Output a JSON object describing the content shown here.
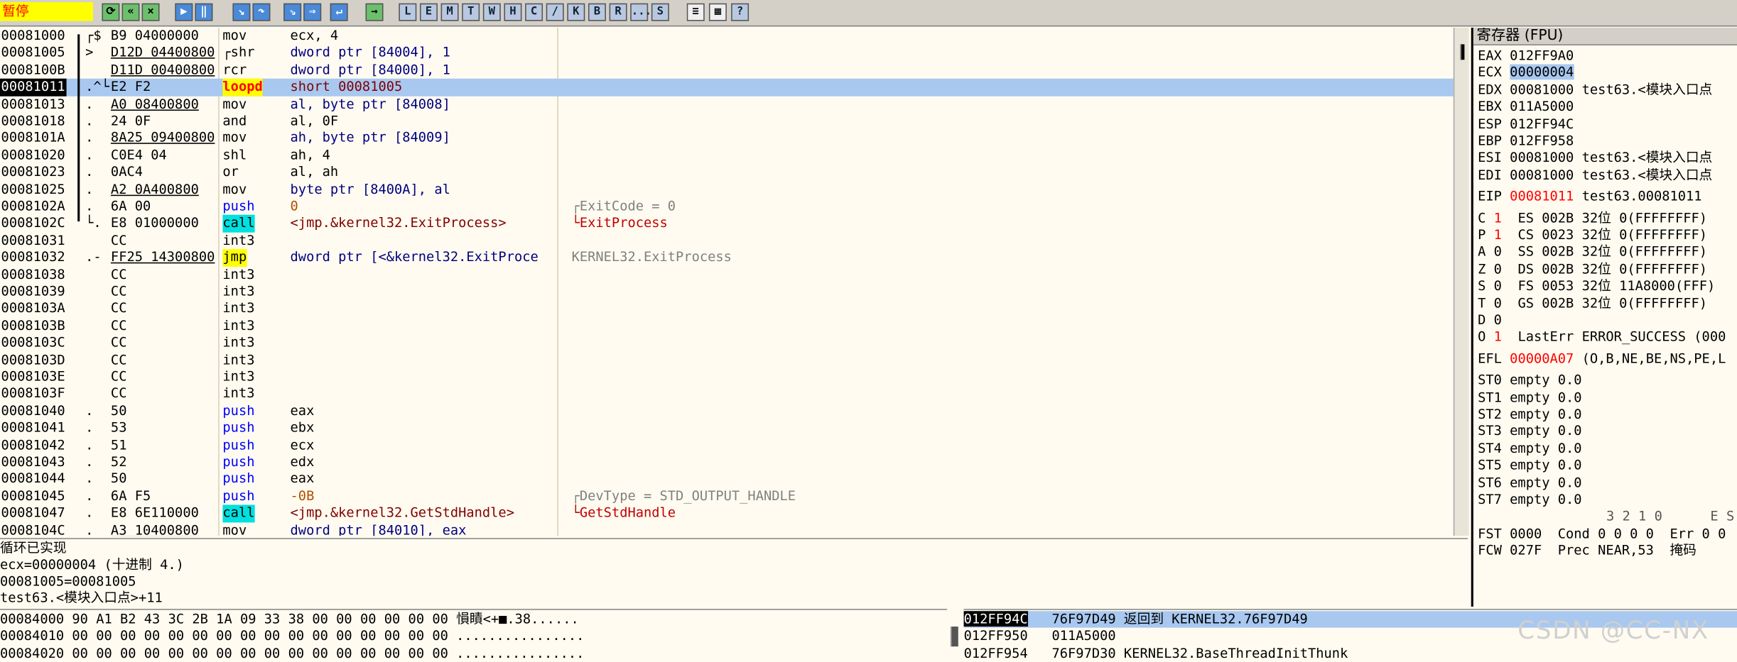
{
  "status": "暂停",
  "toolbar": {
    "buttons": [
      "L",
      "E",
      "M",
      "T",
      "W",
      "H",
      "C",
      "/",
      "K",
      "B",
      "R",
      "...",
      "S"
    ]
  },
  "disasm": [
    {
      "addr": "00081000",
      "dot": "┌$",
      "hex": "B9 04000000",
      "mnem": "mov",
      "ops": "ecx, 4"
    },
    {
      "addr": "00081005",
      "dot": ">",
      "hex": "D12D 04400800",
      "mnem": "┌shr",
      "ops": "dword ptr [84004], 1"
    },
    {
      "addr": "0008100B",
      "dot": "",
      "hex": "D11D 00400800",
      "mnem": "rcr",
      "ops": "dword ptr [84000], 1"
    },
    {
      "addr": "00081011",
      "dot": ".^└",
      "hex": "E2 F2",
      "mnem": "loopd",
      "ops": "short 00081005"
    },
    {
      "addr": "00081013",
      "dot": ".",
      "hex": "A0 08400800",
      "mnem": "mov",
      "ops": "al, byte ptr [84008]"
    },
    {
      "addr": "00081018",
      "dot": ".",
      "hex": "24 0F",
      "mnem": "and",
      "ops": "al, 0F"
    },
    {
      "addr": "0008101A",
      "dot": ".",
      "hex": "8A25 09400800",
      "mnem": "mov",
      "ops": "ah, byte ptr [84009]"
    },
    {
      "addr": "00081020",
      "dot": ".",
      "hex": "C0E4 04",
      "mnem": "shl",
      "ops": "ah, 4"
    },
    {
      "addr": "00081023",
      "dot": ".",
      "hex": "0AC4",
      "mnem": "or",
      "ops": "al, ah"
    },
    {
      "addr": "00081025",
      "dot": ".",
      "hex": "A2 0A400800",
      "mnem": "mov",
      "ops": "byte ptr [8400A], al"
    },
    {
      "addr": "0008102A",
      "dot": ".",
      "hex": "6A 00",
      "mnem": "push",
      "ops": "0",
      "cmt": "┌ExitCode = 0"
    },
    {
      "addr": "0008102C",
      "dot": "└.",
      "hex": "E8 01000000",
      "mnem": "call",
      "ops": "<jmp.&kernel32.ExitProcess>",
      "cmt": "└ExitProcess"
    },
    {
      "addr": "00081031",
      "dot": "",
      "hex": "CC",
      "mnem": "int3",
      "ops": ""
    },
    {
      "addr": "00081032",
      "dot": ".-",
      "hex": "FF25 14300800",
      "mnem": "jmp",
      "ops": "dword ptr [<&kernel32.ExitProce",
      "cmt": "KERNEL32.ExitProcess"
    },
    {
      "addr": "00081038",
      "dot": "",
      "hex": "CC",
      "mnem": "int3",
      "ops": ""
    },
    {
      "addr": "00081039",
      "dot": "",
      "hex": "CC",
      "mnem": "int3",
      "ops": ""
    },
    {
      "addr": "0008103A",
      "dot": "",
      "hex": "CC",
      "mnem": "int3",
      "ops": ""
    },
    {
      "addr": "0008103B",
      "dot": "",
      "hex": "CC",
      "mnem": "int3",
      "ops": ""
    },
    {
      "addr": "0008103C",
      "dot": "",
      "hex": "CC",
      "mnem": "int3",
      "ops": ""
    },
    {
      "addr": "0008103D",
      "dot": "",
      "hex": "CC",
      "mnem": "int3",
      "ops": ""
    },
    {
      "addr": "0008103E",
      "dot": "",
      "hex": "CC",
      "mnem": "int3",
      "ops": ""
    },
    {
      "addr": "0008103F",
      "dot": "",
      "hex": "CC",
      "mnem": "int3",
      "ops": ""
    },
    {
      "addr": "00081040",
      "dot": ".",
      "hex": "50",
      "mnem": "push",
      "ops": "eax"
    },
    {
      "addr": "00081041",
      "dot": ".",
      "hex": "53",
      "mnem": "push",
      "ops": "ebx"
    },
    {
      "addr": "00081042",
      "dot": ".",
      "hex": "51",
      "mnem": "push",
      "ops": "ecx"
    },
    {
      "addr": "00081043",
      "dot": ".",
      "hex": "52",
      "mnem": "push",
      "ops": "edx"
    },
    {
      "addr": "00081044",
      "dot": ".",
      "hex": "50",
      "mnem": "push",
      "ops": "eax"
    },
    {
      "addr": "00081045",
      "dot": ".",
      "hex": "6A F5",
      "mnem": "push",
      "ops": "-0B",
      "cmt": "┌DevType = STD_OUTPUT_HANDLE"
    },
    {
      "addr": "00081047",
      "dot": ".",
      "hex": "E8 6E110000",
      "mnem": "call",
      "ops": "<jmp.&kernel32.GetStdHandle>",
      "cmt": "└GetStdHandle"
    },
    {
      "addr": "0008104C",
      "dot": ".",
      "hex": "A3 10400800",
      "mnem": "mov",
      "ops": "dword ptr [84010], eax"
    }
  ],
  "info": [
    "循环已实现",
    "ecx=00000004 (十进制 4.)",
    "00081005=00081005",
    "test63.<模块入口点>+11"
  ],
  "dump": [
    {
      "addr": "00084000",
      "hex": "90 A1 B2 43 3C 2B 1A 09 33 38 00 00 00 00 00 00",
      "ascii": "愪瞔<+■.38......"
    },
    {
      "addr": "00084010",
      "hex": "00 00 00 00 00 00 00 00 00 00 00 00 00 00 00 00",
      "ascii": "................"
    },
    {
      "addr": "00084020",
      "hex": "00 00 00 00 00 00 00 00 00 00 00 00 00 00 00 00",
      "ascii": "................"
    }
  ],
  "stack": [
    {
      "addr": "012FF94C",
      "val": "76F97D49",
      "cmt": "返回到 KERNEL32.76F97D49"
    },
    {
      "addr": "012FF950",
      "val": "011A5000",
      "cmt": ""
    },
    {
      "addr": "012FF954",
      "val": "76F97D30",
      "cmt": "KERNEL32.BaseThreadInitThunk"
    }
  ],
  "registers": {
    "title": "寄存器 (FPU)",
    "gp": [
      {
        "name": "EAX",
        "val": "012FF9A0",
        "extra": ""
      },
      {
        "name": "ECX",
        "val": "00000004",
        "extra": ""
      },
      {
        "name": "EDX",
        "val": "00081000",
        "extra": "test63.<模块入口点"
      },
      {
        "name": "EBX",
        "val": "011A5000",
        "extra": ""
      },
      {
        "name": "ESP",
        "val": "012FF94C",
        "extra": ""
      },
      {
        "name": "EBP",
        "val": "012FF958",
        "extra": ""
      },
      {
        "name": "ESI",
        "val": "00081000",
        "extra": "test63.<模块入口点"
      },
      {
        "name": "EDI",
        "val": "00081000",
        "extra": "test63.<模块入口点"
      }
    ],
    "eip": {
      "name": "EIP",
      "val": "00081011",
      "extra": "test63.00081011"
    },
    "flags": [
      {
        "f": "C",
        "v": "1",
        "seg": "ES 002B 32位 0(FFFFFFFF)"
      },
      {
        "f": "P",
        "v": "1",
        "seg": "CS 0023 32位 0(FFFFFFFF)"
      },
      {
        "f": "A",
        "v": "0",
        "seg": "SS 002B 32位 0(FFFFFFFF)"
      },
      {
        "f": "Z",
        "v": "0",
        "seg": "DS 002B 32位 0(FFFFFFFF)"
      },
      {
        "f": "S",
        "v": "0",
        "seg": "FS 0053 32位 11A8000(FFF)"
      },
      {
        "f": "T",
        "v": "0",
        "seg": "GS 002B 32位 0(FFFFFFFF)"
      },
      {
        "f": "D",
        "v": "0",
        "seg": ""
      },
      {
        "f": "O",
        "v": "1",
        "seg": "LastErr ERROR_SUCCESS (000"
      }
    ],
    "efl": {
      "name": "EFL",
      "val": "00000A07",
      "extra": "(O,B,NE,BE,NS,PE,L"
    },
    "st": [
      "ST0 empty 0.0",
      "ST1 empty 0.0",
      "ST2 empty 0.0",
      "ST3 empty 0.0",
      "ST4 empty 0.0",
      "ST5 empty 0.0",
      "ST6 empty 0.0",
      "ST7 empty 0.0"
    ],
    "fst_header": "3 2 1 0      E S",
    "fst": "FST 0000  Cond 0 0 0 0  Err 0 0",
    "fcw": "FCW 027F  Prec NEAR,53  掩码"
  },
  "watermark": "CSDN @CC-NX",
  "colors": {
    "selection": "#a8c8f0",
    "status_bg": "#ffff00",
    "call_bg": "#00e0e0",
    "push": "#0000ff",
    "red": "#ff0000"
  }
}
